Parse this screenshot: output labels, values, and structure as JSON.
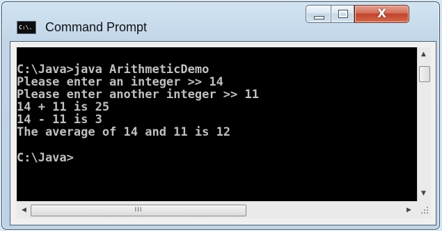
{
  "window": {
    "title": "Command Prompt",
    "icon": "cmd-icon",
    "icon_text": "C:\\."
  },
  "caption_buttons": {
    "minimize": "minimize-icon",
    "maximize": "maximize-icon",
    "close": "close-icon",
    "close_glyph": "X"
  },
  "console": {
    "lines": [
      "C:\\Java>java ArithmeticDemo",
      "Please enter an integer >> 14",
      "Please enter another integer >> 11",
      "14 + 11 is 25",
      "14 - 11 is 3",
      "The average of 14 and 11 is 12",
      "",
      "C:\\Java>"
    ]
  },
  "scrollbars": {
    "up": "▲",
    "down": "▼",
    "left": "◀",
    "right": "▶",
    "grip": "III"
  },
  "colors": {
    "console_bg": "#000000",
    "console_text": "#c0c0c0",
    "close_button": "#c0432a",
    "frame": "#c1d6e8"
  }
}
